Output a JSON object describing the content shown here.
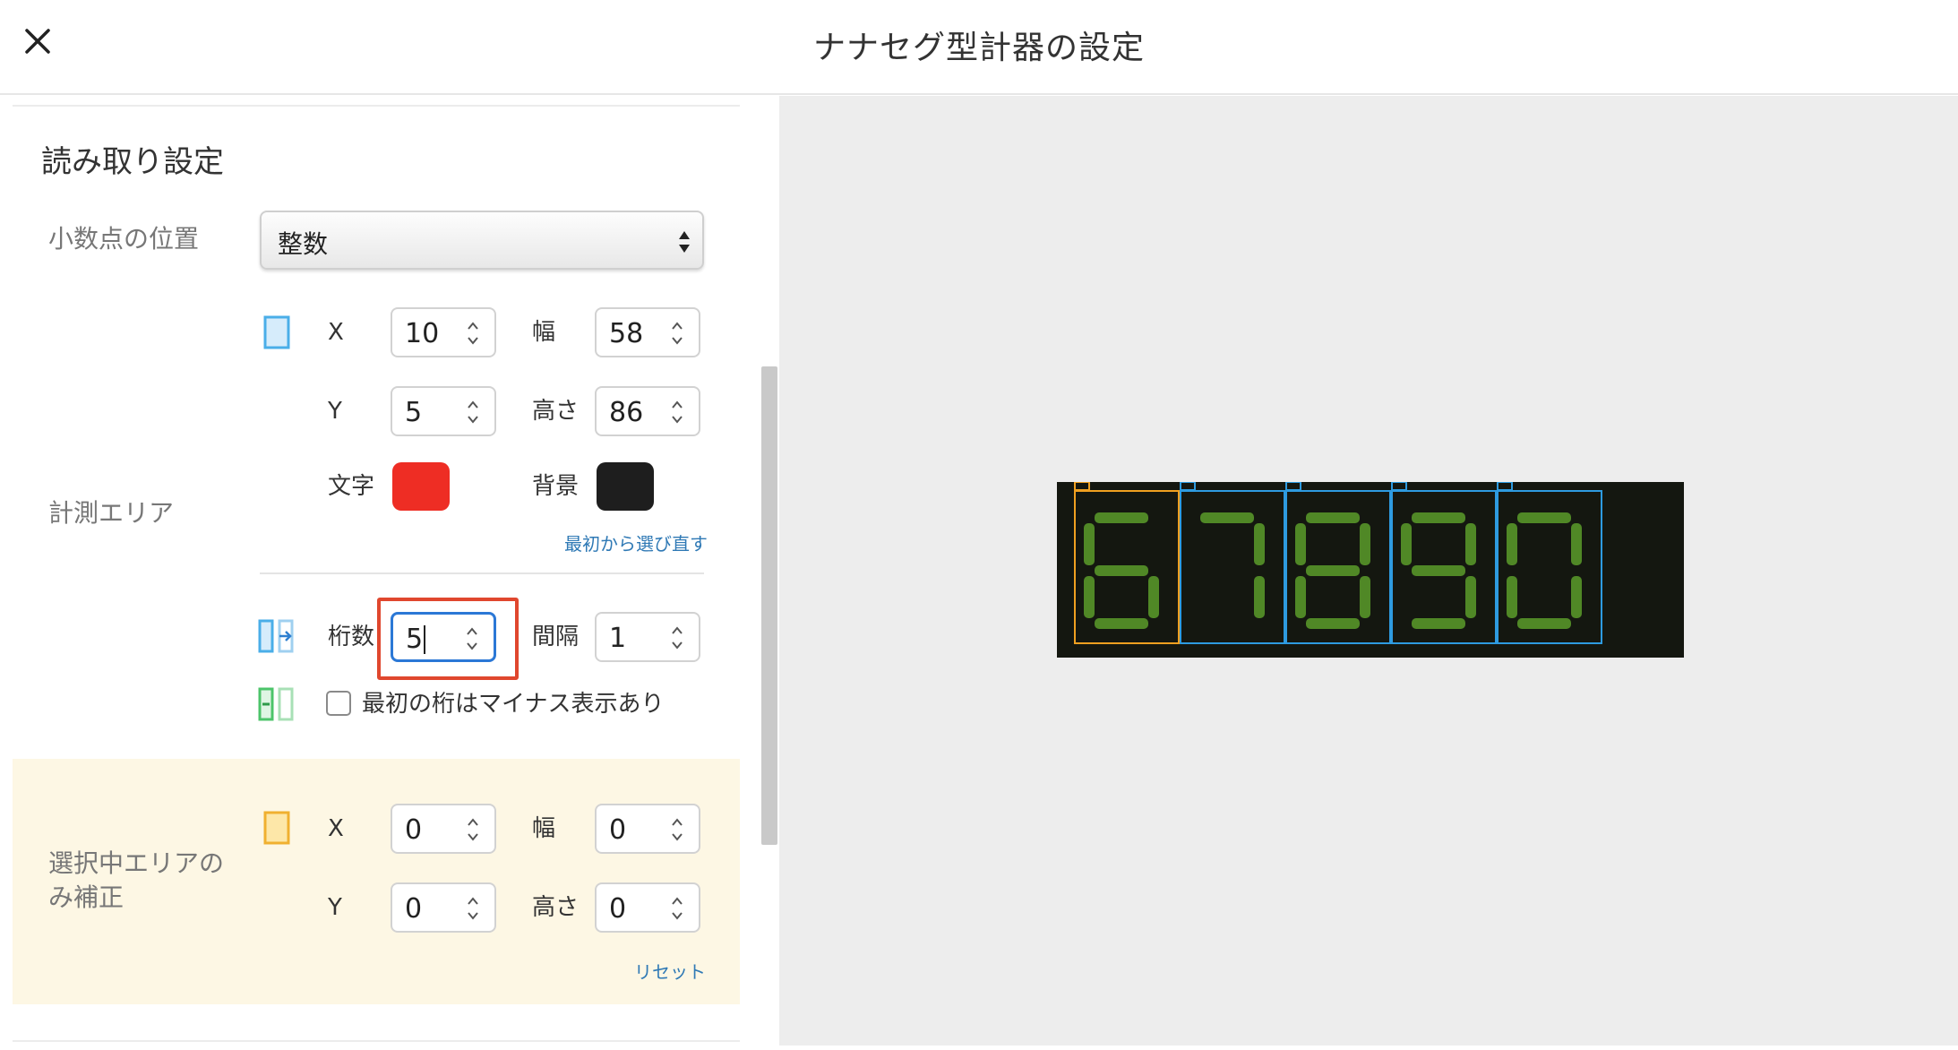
{
  "header": {
    "title": "ナナセグ型計器の設定",
    "close_icon": "close-icon"
  },
  "reading": {
    "section_title": "読み取り設定",
    "decimal_label": "小数点の位置",
    "decimal_value": "整数",
    "measure_label": "計測エリア",
    "x_label": "X",
    "x_value": "10",
    "width_label": "幅",
    "width_value": "58",
    "y_label": "Y",
    "y_value": "5",
    "height_label": "高さ",
    "height_value": "86",
    "text_color_label": "文字",
    "text_color": "#ee2d24",
    "bg_color_label": "背景",
    "bg_color": "#1e1e1e",
    "reselect_link": "最初から選び直す",
    "digits_label": "桁数",
    "digits_value": "5",
    "gap_label": "間隔",
    "gap_value": "1",
    "minus_checkbox_label": "最初の桁はマイナス表示あり"
  },
  "correction": {
    "label_line1": "選択中エリアの",
    "label_line2": "み補正",
    "x_label": "X",
    "x_value": "0",
    "width_label": "幅",
    "width_value": "0",
    "y_label": "Y",
    "y_value": "0",
    "height_label": "高さ",
    "height_value": "0",
    "reset_link": "リセット"
  },
  "preview": {
    "digits": [
      "6",
      "7",
      "8",
      "9",
      "0"
    ]
  },
  "colors": {
    "accent": "#2f79b5",
    "highlight": "#e0472e",
    "selected_digit": "#f0a020",
    "digit_box": "#2e9be0",
    "segment": "#5a9c2a"
  }
}
